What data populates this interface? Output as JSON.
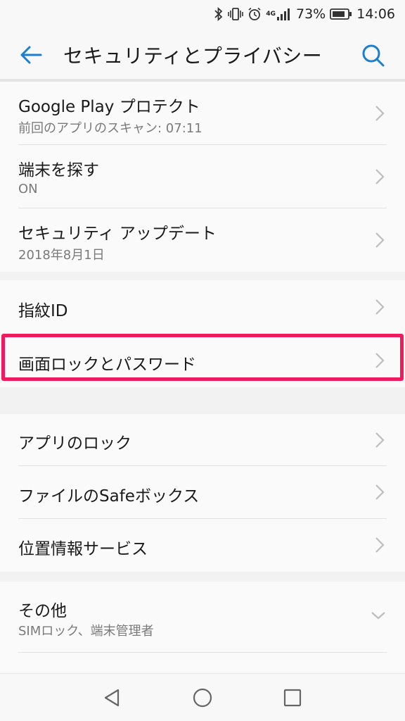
{
  "status_bar": {
    "network": "4G",
    "battery_percent": "73%",
    "time": "14:06"
  },
  "header": {
    "title": "セキュリティとプライバシー",
    "back_icon": "arrow-left-icon",
    "search_icon": "search-icon",
    "accent_color": "#1a7fd0"
  },
  "group1": [
    {
      "label": "Google Play プロテクト",
      "sub": "前回のアプリのスキャン: 07:11"
    },
    {
      "label": "端末を探す",
      "sub": "ON"
    },
    {
      "label": "セキュリティ アップデート",
      "sub": "2018年8月1日"
    }
  ],
  "group2": [
    {
      "label": "指紋ID"
    },
    {
      "label": "画面ロックとパスワード"
    }
  ],
  "group3": [
    {
      "label": "アプリのロック"
    },
    {
      "label": "ファイルのSafeボックス"
    },
    {
      "label": "位置情報サービス"
    }
  ],
  "group4": [
    {
      "label": "その他",
      "sub": "SIMロック、端末管理者"
    }
  ],
  "highlight_color": "#ee1c5f",
  "nav_bar": {
    "back": "triangle-back-icon",
    "home": "circle-home-icon",
    "recents": "square-recents-icon"
  }
}
